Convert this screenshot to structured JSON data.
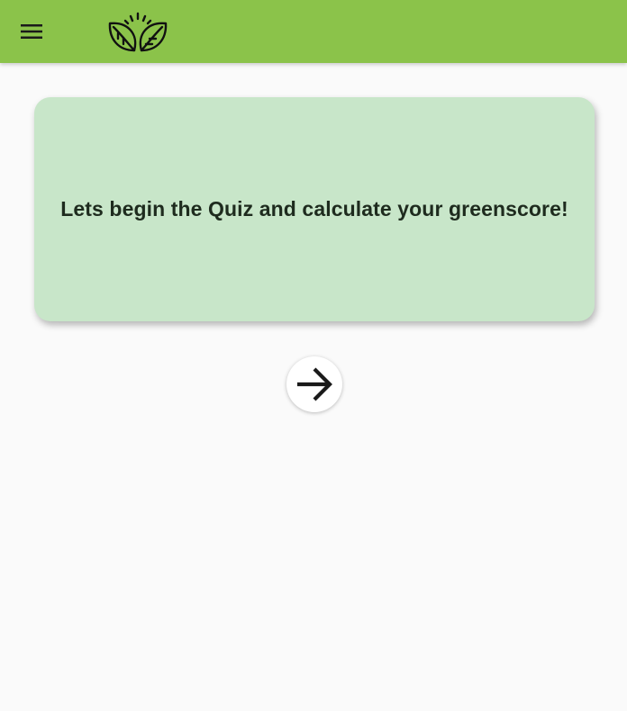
{
  "colors": {
    "appbar": "#8bc34a",
    "card": "#c8e6c9",
    "background": "#fafafa",
    "button": "#ffffff",
    "icon": "#1a1a1a"
  },
  "header": {
    "menu_icon": "hamburger-menu-icon",
    "logo_icon": "leaves-logo-icon"
  },
  "quiz": {
    "intro_text": "Lets begin the Quiz and calculate your greenscore!",
    "next_icon": "arrow-right-icon"
  }
}
